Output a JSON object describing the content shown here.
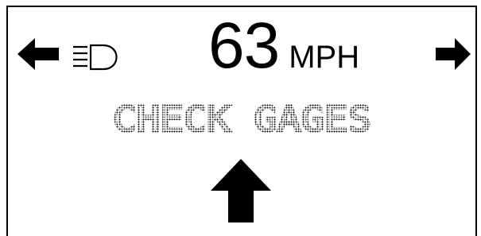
{
  "speedometer": {
    "value": "63",
    "unit": "MPH"
  },
  "message": {
    "text": "CHECK GAGES"
  },
  "indicators": {
    "left_turn": "left-arrow-icon",
    "right_turn": "right-arrow-icon",
    "headlamp": "headlamp-icon",
    "straight_ahead": "up-arrow-icon"
  },
  "colors": {
    "foreground": "#000000",
    "background": "#ffffff"
  }
}
